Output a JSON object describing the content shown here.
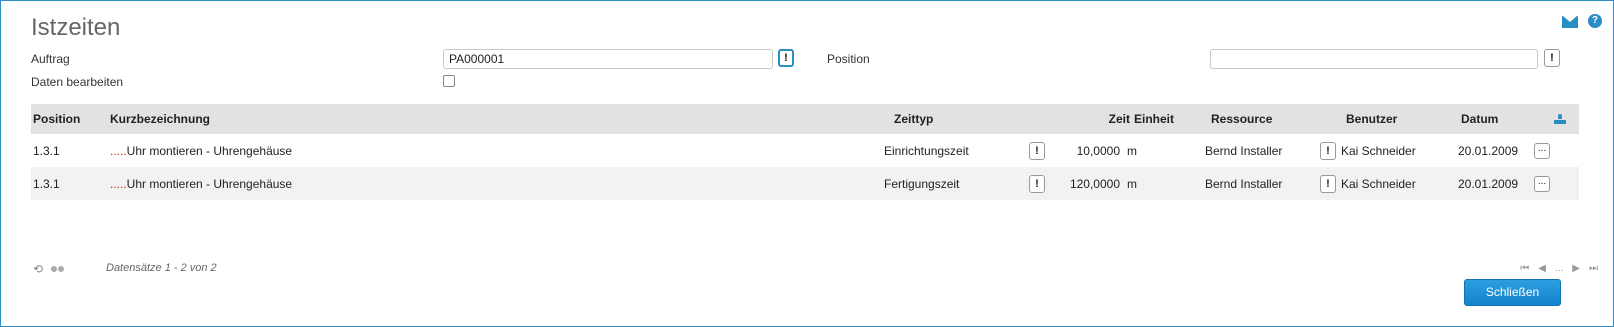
{
  "page": {
    "title": "Istzeiten"
  },
  "form": {
    "auftrag_label": "Auftrag",
    "auftrag_value": "PA000001",
    "position_label": "Position",
    "position_value": "",
    "daten_label": "Daten bearbeiten",
    "daten_checked": false,
    "lookup_glyph": "!"
  },
  "grid": {
    "headers": {
      "position": "Position",
      "kurz": "Kurzbezeichnung",
      "zeittyp": "Zeittyp",
      "zeit": "Zeit",
      "einheit": "Einheit",
      "ressource": "Ressource",
      "benutzer": "Benutzer",
      "datum": "Datum"
    },
    "rows": [
      {
        "position": "1.3.1",
        "prefix": ".....",
        "kurz": "Uhr montieren - Uhrengehäuse",
        "zeittyp": "Einrichtungszeit",
        "zeit": "10,0000",
        "einheit": "m",
        "ressource": "Bernd Installer",
        "benutzer": "Kai Schneider",
        "datum": "20.01.2009"
      },
      {
        "position": "1.3.1",
        "prefix": ".....",
        "kurz": "Uhr montieren - Uhrengehäuse",
        "zeittyp": "Fertigungszeit",
        "zeit": "120,0000",
        "einheit": "m",
        "ressource": "Bernd Installer",
        "benutzer": "Kai Schneider",
        "datum": "20.01.2009"
      }
    ],
    "more_glyph": "..."
  },
  "footer": {
    "records": "Datensätze 1 - 2 von 2",
    "pager": {
      "first": "⏮",
      "prev": "◀",
      "ellipsis": "...",
      "next": "▶",
      "last": "⏭"
    },
    "close_label": "Schließen"
  },
  "colors": {
    "accent": "#2a8ec4",
    "header_bg": "#e2e2e2",
    "alt_row": "#f2f2f2"
  }
}
